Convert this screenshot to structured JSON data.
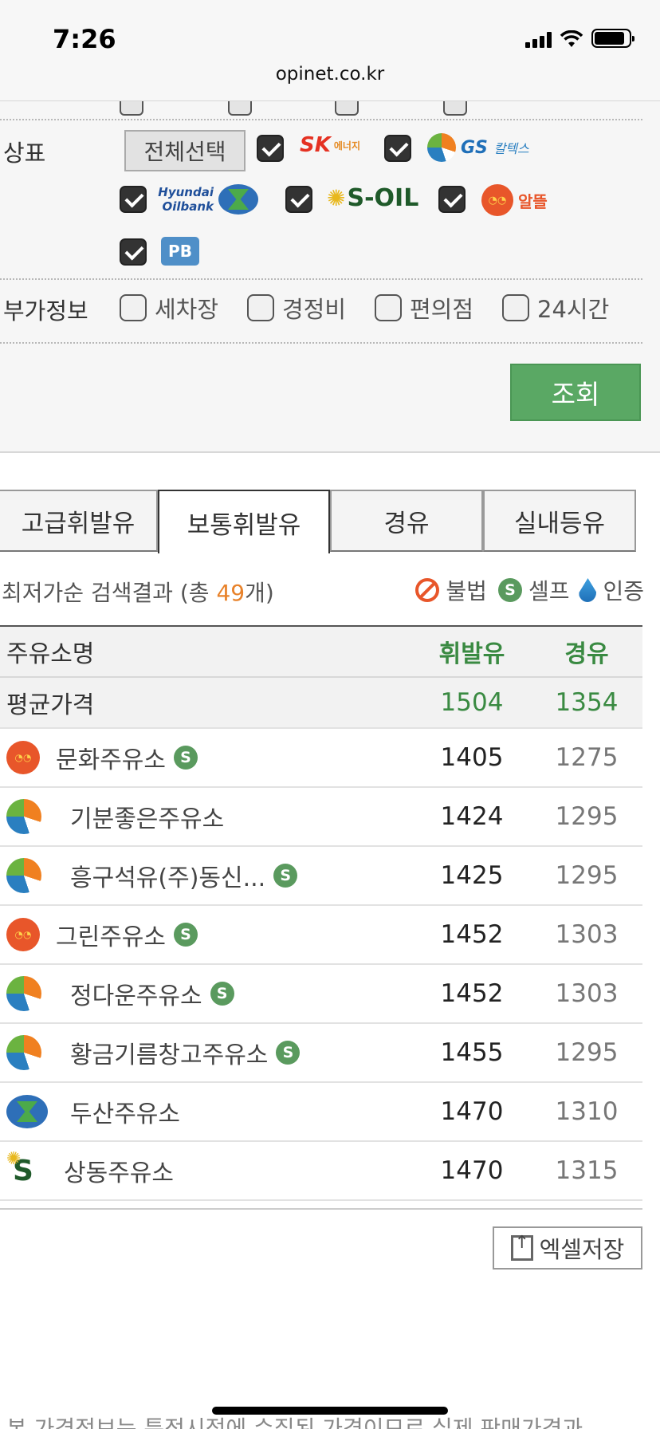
{
  "status": {
    "time": "7:26",
    "url": "opinet.co.kr"
  },
  "filter": {
    "brand_label": "상표",
    "select_all": "전체선택",
    "brands": {
      "sk": "SK",
      "sk_sub": "에너지",
      "gs": "GS",
      "gs_sub": "칼텍스",
      "hyundai": "Hyundai Oilbank",
      "soil": "S-OIL",
      "alttle": "알뜰",
      "pb": "PB"
    },
    "extra_label": "부가정보",
    "options": [
      "세차장",
      "경정비",
      "편의점",
      "24시간"
    ],
    "search_button": "조회"
  },
  "tabs": [
    "고급휘발유",
    "보통휘발유",
    "경유",
    "실내등유"
  ],
  "active_tab": 1,
  "results": {
    "summary_prefix": "최저가순 검색결과 (총 ",
    "count": "49",
    "summary_suffix": "개)",
    "legend": {
      "illegal": "불법",
      "self": "셀프",
      "certified": "인증"
    }
  },
  "table": {
    "headers": {
      "name": "주유소명",
      "gasoline": "휘발유",
      "diesel": "경유"
    },
    "average": {
      "name": "평균가격",
      "gasoline": "1504",
      "diesel": "1354"
    },
    "rows": [
      {
        "name": "문화주유소",
        "brand": "alttle",
        "self": true,
        "gasoline": "1405",
        "diesel": "1275"
      },
      {
        "name": "기분좋은주유소",
        "brand": "gs",
        "self": false,
        "gasoline": "1424",
        "diesel": "1295"
      },
      {
        "name": "흥구석유(주)동신...",
        "brand": "gs",
        "self": true,
        "gasoline": "1425",
        "diesel": "1295"
      },
      {
        "name": "그린주유소",
        "brand": "alttle",
        "self": true,
        "gasoline": "1452",
        "diesel": "1303"
      },
      {
        "name": "정다운주유소",
        "brand": "gs",
        "self": true,
        "gasoline": "1452",
        "diesel": "1303"
      },
      {
        "name": "황금기름창고주유소",
        "brand": "gs",
        "self": true,
        "gasoline": "1455",
        "diesel": "1295"
      },
      {
        "name": "두산주유소",
        "brand": "hyundai",
        "self": false,
        "gasoline": "1470",
        "diesel": "1310"
      },
      {
        "name": "상동주유소",
        "brand": "soil",
        "self": false,
        "gasoline": "1470",
        "diesel": "1315"
      }
    ],
    "self_mark": "S"
  },
  "excel_button": "엑셀저장",
  "bottom_note": "본 가격정보는 특정시점에 수집된 가격이므로 실제 판매가격과"
}
